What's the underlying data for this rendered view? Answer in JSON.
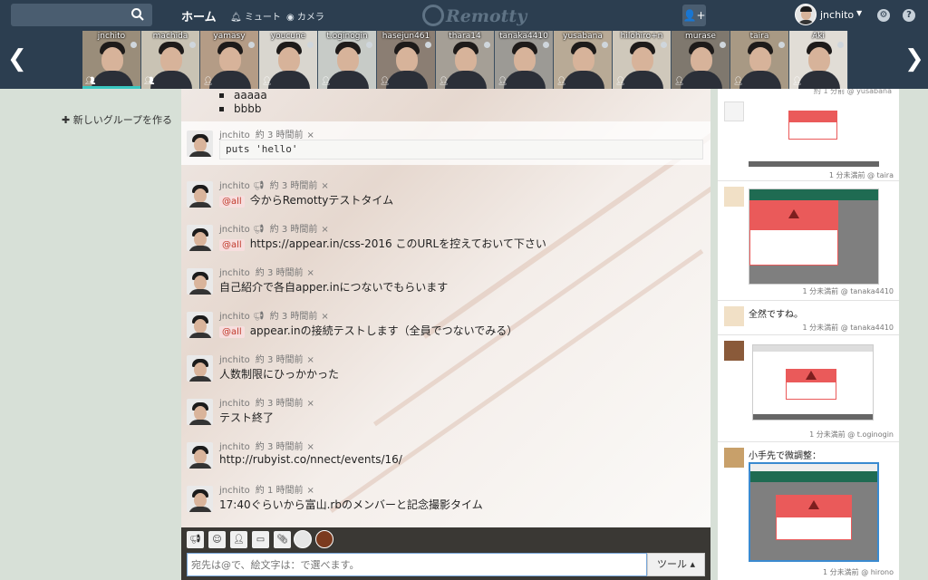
{
  "nav": {
    "home": "ホーム",
    "mute": "ミュート",
    "camera": "カメラ",
    "brand": "Remotty",
    "user": "jnchito"
  },
  "cameras": [
    {
      "name": "jnchito",
      "bg": "#9a8d7a",
      "active": true
    },
    {
      "name": "machida",
      "bg": "#c9c3b4",
      "active": false
    },
    {
      "name": "yamasy",
      "bg": "#b49c86",
      "active": false
    },
    {
      "name": "youcune",
      "bg": "#d9d6cf",
      "active": false
    },
    {
      "name": "t.oginogin",
      "bg": "#c7cbc7",
      "active": false
    },
    {
      "name": "hasejun461",
      "bg": "#8b7e73",
      "active": false
    },
    {
      "name": "thara14",
      "bg": "#a59f96",
      "active": false
    },
    {
      "name": "tanaka4410",
      "bg": "#9c9a95",
      "active": false
    },
    {
      "name": "yusabana",
      "bg": "#b8aa96",
      "active": false
    },
    {
      "name": "hilohiro+n",
      "bg": "#cfc8bb",
      "active": false
    },
    {
      "name": "murase",
      "bg": "#7f786e",
      "active": false
    },
    {
      "name": "taira",
      "bg": "#a89984",
      "active": false
    },
    {
      "name": "Aki",
      "bg": "#e1ddd6",
      "active": false
    }
  ],
  "sidebar": {
    "new_group": "新しいグループを作る"
  },
  "bullets": [
    "aaaaa",
    "bbbb"
  ],
  "messages": [
    {
      "user": "jnchito",
      "time": "約 3 時間前",
      "code": "puts 'hello'"
    },
    {
      "user": "jnchito",
      "time": "約 3 時間前",
      "mention": "@all",
      "text": "今からRemottyテストタイム"
    },
    {
      "user": "jnchito",
      "time": "約 3 時間前",
      "mention": "@all",
      "text": "https://appear.in/css-2016 このURLを控えておいて下さい"
    },
    {
      "user": "jnchito",
      "time": "約 3 時間前",
      "text": "自己紹介で各自apper.inにつないでもらいます"
    },
    {
      "user": "jnchito",
      "time": "約 3 時間前",
      "mention": "@all",
      "text": "appear.inの接続テストします（全員でつないでみる）"
    },
    {
      "user": "jnchito",
      "time": "約 3 時間前",
      "text": "人数制限にひっかかった"
    },
    {
      "user": "jnchito",
      "time": "約 3 時間前",
      "text": "テスト終了"
    },
    {
      "user": "jnchito",
      "time": "約 3 時間前",
      "text": "http://rubyist.co/nnect/events/16/"
    },
    {
      "user": "jnchito",
      "time": "約 1 時間前",
      "text": "17:40ぐらいから富山.rbのメンバーと記念撮影タイム"
    }
  ],
  "input": {
    "placeholder": "宛先は@で、絵文字は：で選べます。",
    "tools": "ツール ▴"
  },
  "feed": {
    "top_meta": "約 1 分前 @ yusabana",
    "cards": [
      {
        "meta": "1 分未満前 @ taira"
      },
      {
        "meta": "1 分未満前 @ tanaka4410"
      },
      {
        "text": "全然ですね。",
        "meta": "1 分未満前 @ tanaka4410"
      },
      {
        "meta": "1 分未満前 @ t.oginogin"
      },
      {
        "text": "小手先で微調整：",
        "meta": "1 分未満前 @ hirono"
      }
    ]
  },
  "colors": {
    "navbar": "#2c3e50",
    "accent": "#3ac7c0",
    "mention": "#c0392b",
    "warning": "#ea5a5a"
  }
}
